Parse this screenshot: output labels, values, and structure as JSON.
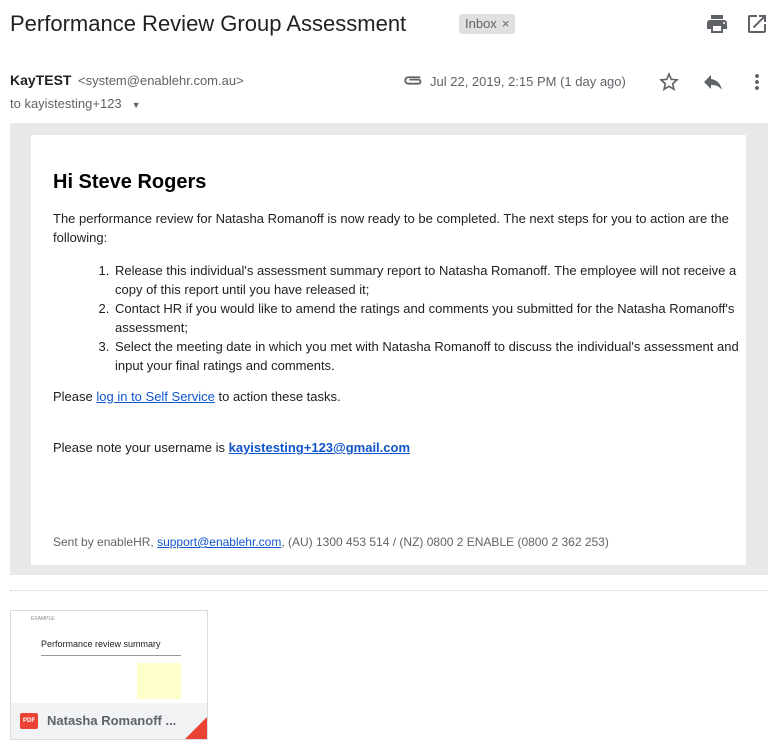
{
  "header": {
    "subject": "Performance Review Group Assessment",
    "label": "Inbox",
    "label_remove": "×",
    "print_icon": "printer-icon",
    "popout_icon": "open-in-new-window-icon"
  },
  "sender": {
    "name": "KayTEST",
    "email": "<system@enablehr.com.au>",
    "to": "to kayistesting+123",
    "date": "Jul 22, 2019, 2:15 PM (1 day ago)",
    "attachment_icon": "paperclip-icon",
    "star_icon": "star-icon",
    "reply_icon": "reply-icon",
    "more_icon": "more-vertical-icon"
  },
  "body": {
    "greeting": "Hi Steve Rogers",
    "intro": "The performance review for Natasha Romanoff is now ready to be completed. The next steps for you to action are the following:",
    "steps": [
      "Release this individual's assessment summary report to Natasha Romanoff. The employee will not receive a copy of this report until you have released it;",
      "Contact HR if you would like to amend the ratings and comments you submitted for the Natasha Romanoff's assessment;",
      "Select the meeting date in which you met with Natasha Romanoff to discuss the individual's assessment and input your final ratings and comments."
    ],
    "please_prefix": "Please ",
    "please_link": "log in to Self Service",
    "please_suffix": " to action these tasks.",
    "username_prefix": "Please note your username is ",
    "username": "kayistesting+123@gmail.com",
    "footer_prefix": "Sent by enableHR, ",
    "footer_link": "support@enablehr.com",
    "footer_suffix": ", (AU) 1300 453 514 / (NZ) 0800 2 ENABLE (0800 2 362 253)"
  },
  "attachment": {
    "type_badge": "PDF",
    "name": "Natasha Romanoff ...",
    "preview_title": "Performance review summary",
    "preview_logo": "EXAMPLE"
  },
  "colors": {
    "link": "#1155cc",
    "pdf_red": "#ea4335",
    "outer_bg": "#e8e8e8"
  }
}
